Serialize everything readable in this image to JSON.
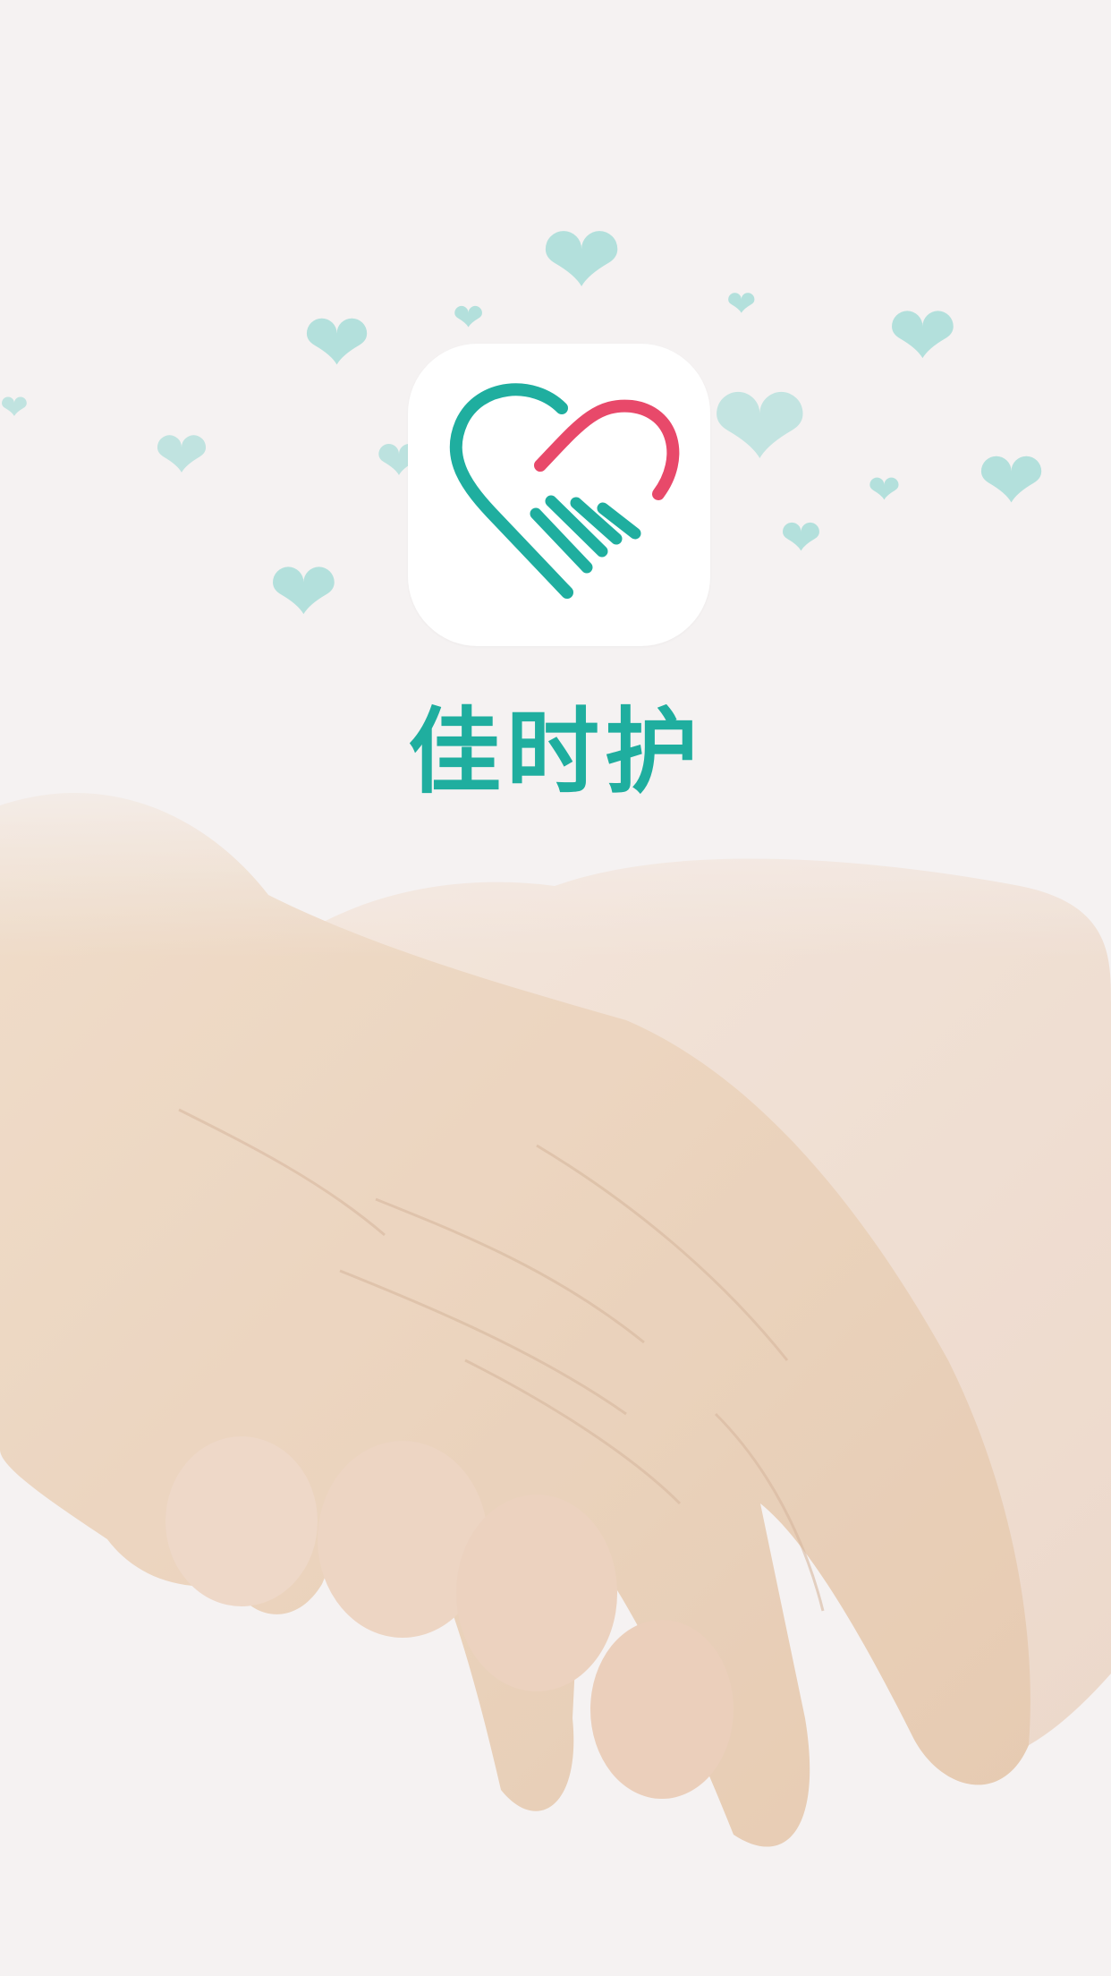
{
  "splash": {
    "app_name": "佳时护",
    "logo_icon": "heart-hands-icon",
    "background_image": "holding-hands-photo",
    "colors": {
      "brand_teal": "#1fae9f",
      "brand_pink": "#e8496a",
      "heart_decor": "#b3e0dc",
      "background": "#f5f2f2"
    }
  }
}
